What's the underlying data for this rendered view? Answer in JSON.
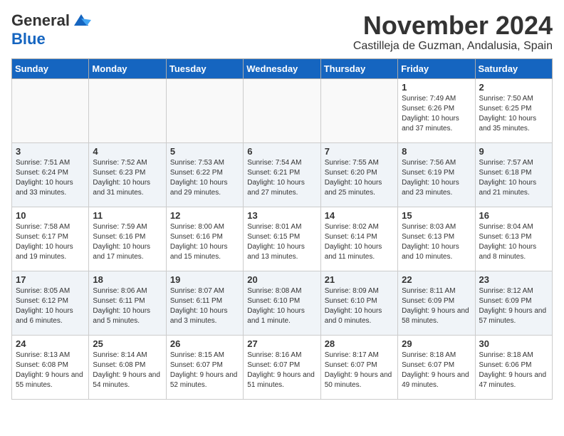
{
  "header": {
    "logo_general": "General",
    "logo_blue": "Blue",
    "month_title": "November 2024",
    "location": "Castilleja de Guzman, Andalusia, Spain"
  },
  "weekdays": [
    "Sunday",
    "Monday",
    "Tuesday",
    "Wednesday",
    "Thursday",
    "Friday",
    "Saturday"
  ],
  "weeks": [
    [
      {
        "day": "",
        "info": ""
      },
      {
        "day": "",
        "info": ""
      },
      {
        "day": "",
        "info": ""
      },
      {
        "day": "",
        "info": ""
      },
      {
        "day": "",
        "info": ""
      },
      {
        "day": "1",
        "info": "Sunrise: 7:49 AM\nSunset: 6:26 PM\nDaylight: 10 hours and 37 minutes."
      },
      {
        "day": "2",
        "info": "Sunrise: 7:50 AM\nSunset: 6:25 PM\nDaylight: 10 hours and 35 minutes."
      }
    ],
    [
      {
        "day": "3",
        "info": "Sunrise: 7:51 AM\nSunset: 6:24 PM\nDaylight: 10 hours and 33 minutes."
      },
      {
        "day": "4",
        "info": "Sunrise: 7:52 AM\nSunset: 6:23 PM\nDaylight: 10 hours and 31 minutes."
      },
      {
        "day": "5",
        "info": "Sunrise: 7:53 AM\nSunset: 6:22 PM\nDaylight: 10 hours and 29 minutes."
      },
      {
        "day": "6",
        "info": "Sunrise: 7:54 AM\nSunset: 6:21 PM\nDaylight: 10 hours and 27 minutes."
      },
      {
        "day": "7",
        "info": "Sunrise: 7:55 AM\nSunset: 6:20 PM\nDaylight: 10 hours and 25 minutes."
      },
      {
        "day": "8",
        "info": "Sunrise: 7:56 AM\nSunset: 6:19 PM\nDaylight: 10 hours and 23 minutes."
      },
      {
        "day": "9",
        "info": "Sunrise: 7:57 AM\nSunset: 6:18 PM\nDaylight: 10 hours and 21 minutes."
      }
    ],
    [
      {
        "day": "10",
        "info": "Sunrise: 7:58 AM\nSunset: 6:17 PM\nDaylight: 10 hours and 19 minutes."
      },
      {
        "day": "11",
        "info": "Sunrise: 7:59 AM\nSunset: 6:16 PM\nDaylight: 10 hours and 17 minutes."
      },
      {
        "day": "12",
        "info": "Sunrise: 8:00 AM\nSunset: 6:16 PM\nDaylight: 10 hours and 15 minutes."
      },
      {
        "day": "13",
        "info": "Sunrise: 8:01 AM\nSunset: 6:15 PM\nDaylight: 10 hours and 13 minutes."
      },
      {
        "day": "14",
        "info": "Sunrise: 8:02 AM\nSunset: 6:14 PM\nDaylight: 10 hours and 11 minutes."
      },
      {
        "day": "15",
        "info": "Sunrise: 8:03 AM\nSunset: 6:13 PM\nDaylight: 10 hours and 10 minutes."
      },
      {
        "day": "16",
        "info": "Sunrise: 8:04 AM\nSunset: 6:13 PM\nDaylight: 10 hours and 8 minutes."
      }
    ],
    [
      {
        "day": "17",
        "info": "Sunrise: 8:05 AM\nSunset: 6:12 PM\nDaylight: 10 hours and 6 minutes."
      },
      {
        "day": "18",
        "info": "Sunrise: 8:06 AM\nSunset: 6:11 PM\nDaylight: 10 hours and 5 minutes."
      },
      {
        "day": "19",
        "info": "Sunrise: 8:07 AM\nSunset: 6:11 PM\nDaylight: 10 hours and 3 minutes."
      },
      {
        "day": "20",
        "info": "Sunrise: 8:08 AM\nSunset: 6:10 PM\nDaylight: 10 hours and 1 minute."
      },
      {
        "day": "21",
        "info": "Sunrise: 8:09 AM\nSunset: 6:10 PM\nDaylight: 10 hours and 0 minutes."
      },
      {
        "day": "22",
        "info": "Sunrise: 8:11 AM\nSunset: 6:09 PM\nDaylight: 9 hours and 58 minutes."
      },
      {
        "day": "23",
        "info": "Sunrise: 8:12 AM\nSunset: 6:09 PM\nDaylight: 9 hours and 57 minutes."
      }
    ],
    [
      {
        "day": "24",
        "info": "Sunrise: 8:13 AM\nSunset: 6:08 PM\nDaylight: 9 hours and 55 minutes."
      },
      {
        "day": "25",
        "info": "Sunrise: 8:14 AM\nSunset: 6:08 PM\nDaylight: 9 hours and 54 minutes."
      },
      {
        "day": "26",
        "info": "Sunrise: 8:15 AM\nSunset: 6:07 PM\nDaylight: 9 hours and 52 minutes."
      },
      {
        "day": "27",
        "info": "Sunrise: 8:16 AM\nSunset: 6:07 PM\nDaylight: 9 hours and 51 minutes."
      },
      {
        "day": "28",
        "info": "Sunrise: 8:17 AM\nSunset: 6:07 PM\nDaylight: 9 hours and 50 minutes."
      },
      {
        "day": "29",
        "info": "Sunrise: 8:18 AM\nSunset: 6:07 PM\nDaylight: 9 hours and 49 minutes."
      },
      {
        "day": "30",
        "info": "Sunrise: 8:18 AM\nSunset: 6:06 PM\nDaylight: 9 hours and 47 minutes."
      }
    ]
  ]
}
